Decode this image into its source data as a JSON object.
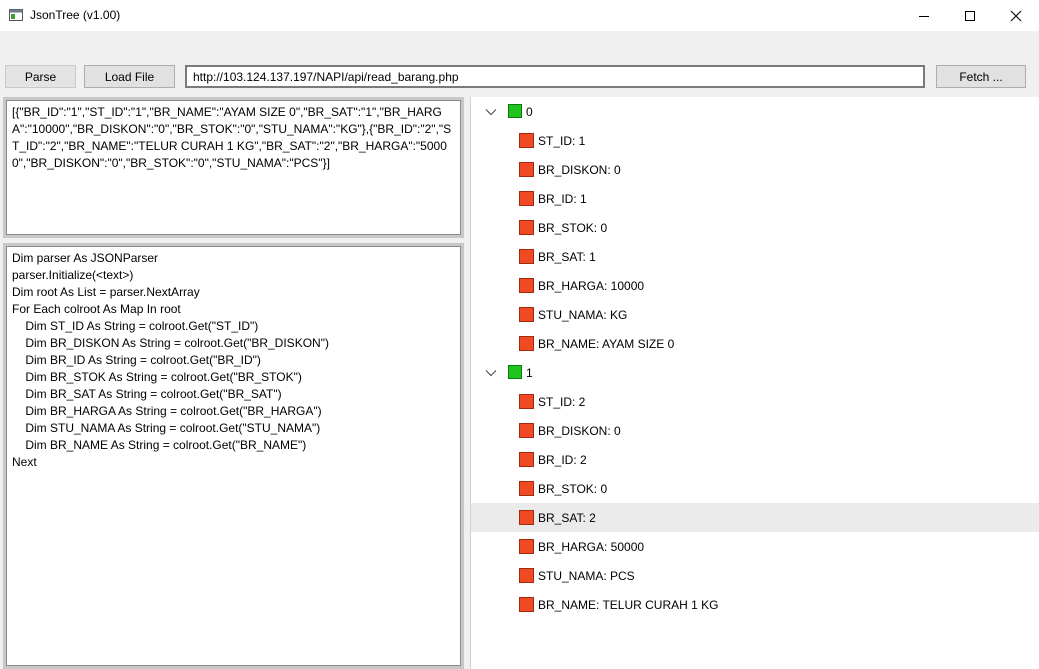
{
  "window": {
    "title": "JsonTree (v1.00)"
  },
  "toolbar": {
    "parse_label": "Parse",
    "load_file_label": "Load File",
    "url_value": "http://103.124.137.197/NAPI/api/read_barang.php",
    "fetch_label": "Fetch ..."
  },
  "json_text": "[{\"BR_ID\":\"1\",\"ST_ID\":\"1\",\"BR_NAME\":\"AYAM SIZE 0\",\"BR_SAT\":\"1\",\"BR_HARGA\":\"10000\",\"BR_DISKON\":\"0\",\"BR_STOK\":\"0\",\"STU_NAMA\":\"KG\"},{\"BR_ID\":\"2\",\"ST_ID\":\"2\",\"BR_NAME\":\"TELUR CURAH 1 KG\",\"BR_SAT\":\"2\",\"BR_HARGA\":\"50000\",\"BR_DISKON\":\"0\",\"BR_STOK\":\"0\",\"STU_NAMA\":\"PCS\"}]",
  "code_text": "Dim parser As JSONParser\nparser.Initialize(<text>)\nDim root As List = parser.NextArray\nFor Each colroot As Map In root\n\tDim ST_ID As String = colroot.Get(\"ST_ID\")\n\tDim BR_DISKON As String = colroot.Get(\"BR_DISKON\")\n\tDim BR_ID As String = colroot.Get(\"BR_ID\")\n\tDim BR_STOK As String = colroot.Get(\"BR_STOK\")\n\tDim BR_SAT As String = colroot.Get(\"BR_SAT\")\n\tDim BR_HARGA As String = colroot.Get(\"BR_HARGA\")\n\tDim STU_NAMA As String = colroot.Get(\"STU_NAMA\")\n\tDim BR_NAME As String = colroot.Get(\"BR_NAME\")\nNext",
  "tree": {
    "nodes": [
      {
        "label": "0",
        "children": [
          "ST_ID: 1",
          "BR_DISKON: 0",
          "BR_ID: 1",
          "BR_STOK: 0",
          "BR_SAT: 1",
          "BR_HARGA: 10000",
          "STU_NAMA: KG",
          "BR_NAME: AYAM SIZE 0"
        ]
      },
      {
        "label": "1",
        "children": [
          "ST_ID: 2",
          "BR_DISKON: 0",
          "BR_ID: 2",
          "BR_STOK: 0",
          "BR_SAT: 2",
          "BR_HARGA: 50000",
          "STU_NAMA: PCS",
          "BR_NAME: TELUR CURAH 1 KG"
        ]
      }
    ],
    "selected": "1.4",
    "colors": {
      "object_node": "#1fc41f",
      "leaf_node": "#f04a24",
      "selection": "#ebebeb"
    }
  },
  "icons": {
    "app": "app-window-icon",
    "minimize": "minimize-icon",
    "maximize": "maximize-icon",
    "close": "close-icon",
    "expand": "chevron-down-icon"
  }
}
